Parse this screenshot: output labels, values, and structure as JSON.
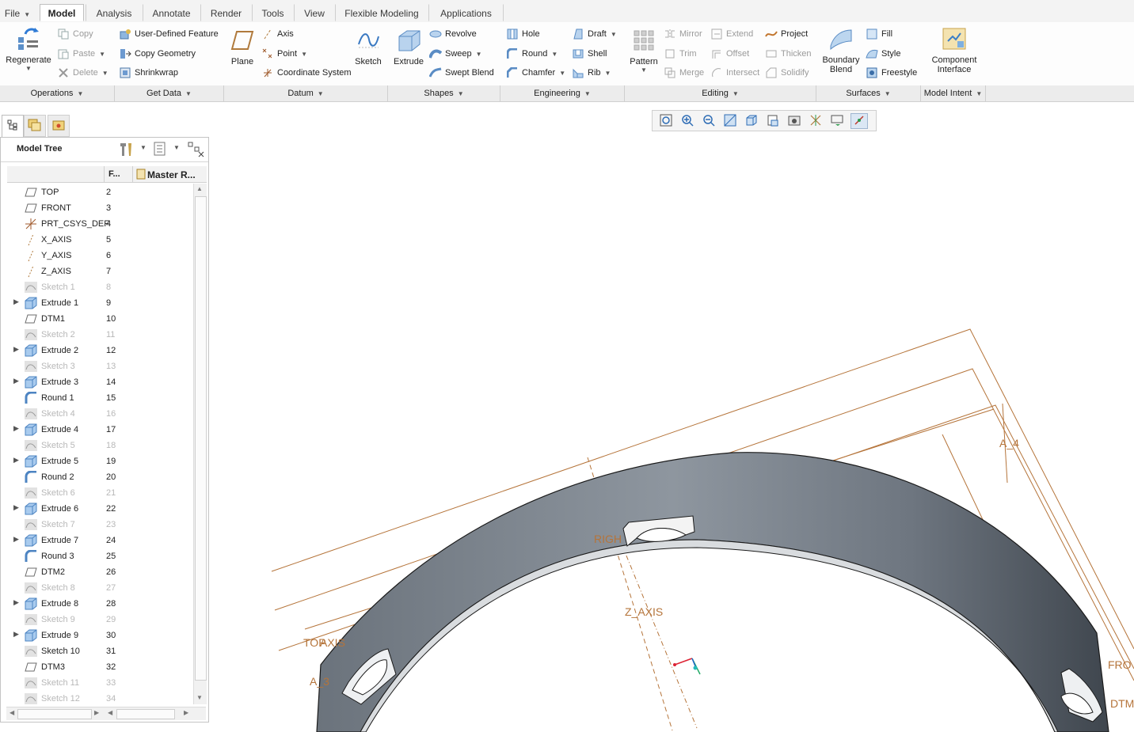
{
  "menu_tabs": [
    "File",
    "Model",
    "Analysis",
    "Annotate",
    "Render",
    "Tools",
    "View",
    "Flexible Modeling",
    "Applications"
  ],
  "ribbon": {
    "regenerate": "Regenerate",
    "copy": "Copy",
    "paste": "Paste",
    "delete": "Delete",
    "user_defined_feature": "User-Defined Feature",
    "copy_geometry": "Copy Geometry",
    "shrinkwrap": "Shrinkwrap",
    "plane": "Plane",
    "axis": "Axis",
    "point": "Point",
    "coordinate_system": "Coordinate System",
    "sketch": "Sketch",
    "extrude": "Extrude",
    "revolve": "Revolve",
    "sweep": "Sweep",
    "swept_blend": "Swept Blend",
    "hole": "Hole",
    "round": "Round",
    "chamfer": "Chamfer",
    "draft": "Draft",
    "shell": "Shell",
    "rib": "Rib",
    "pattern": "Pattern",
    "mirror": "Mirror",
    "trim": "Trim",
    "merge": "Merge",
    "extend": "Extend",
    "offset": "Offset",
    "intersect": "Intersect",
    "project": "Project",
    "thicken": "Thicken",
    "solidify": "Solidify",
    "boundary_blend_1": "Boundary",
    "boundary_blend_2": "Blend",
    "fill": "Fill",
    "style": "Style",
    "freestyle": "Freestyle",
    "component_interface_1": "Component",
    "component_interface_2": "Interface"
  },
  "groups": [
    "Operations",
    "Get Data",
    "Datum",
    "Shapes",
    "Engineering",
    "Editing",
    "Surfaces",
    "Model Intent"
  ],
  "tree": {
    "title": "Model Tree",
    "col_feature": "F...",
    "col_master": "Master R...",
    "items": [
      {
        "name": "TOP",
        "num": "2",
        "icon": "datum-plane",
        "expand": false,
        "dim": false
      },
      {
        "name": "FRONT",
        "num": "3",
        "icon": "datum-plane",
        "expand": false,
        "dim": false
      },
      {
        "name": "PRT_CSYS_DEF",
        "num": "4",
        "icon": "csys",
        "expand": false,
        "dim": false
      },
      {
        "name": "X_AXIS",
        "num": "5",
        "icon": "axis",
        "expand": false,
        "dim": false
      },
      {
        "name": "Y_AXIS",
        "num": "6",
        "icon": "axis",
        "expand": false,
        "dim": false
      },
      {
        "name": "Z_AXIS",
        "num": "7",
        "icon": "axis",
        "expand": false,
        "dim": false
      },
      {
        "name": "Sketch 1",
        "num": "8",
        "icon": "sketch",
        "expand": false,
        "dim": true
      },
      {
        "name": "Extrude 1",
        "num": "9",
        "icon": "extrude",
        "expand": true,
        "dim": false
      },
      {
        "name": "DTM1",
        "num": "10",
        "icon": "datum-plane",
        "expand": false,
        "dim": false
      },
      {
        "name": "Sketch 2",
        "num": "11",
        "icon": "sketch",
        "expand": false,
        "dim": true
      },
      {
        "name": "Extrude 2",
        "num": "12",
        "icon": "extrude",
        "expand": true,
        "dim": false
      },
      {
        "name": "Sketch 3",
        "num": "13",
        "icon": "sketch",
        "expand": false,
        "dim": true
      },
      {
        "name": "Extrude 3",
        "num": "14",
        "icon": "extrude",
        "expand": true,
        "dim": false
      },
      {
        "name": "Round 1",
        "num": "15",
        "icon": "round",
        "expand": false,
        "dim": false
      },
      {
        "name": "Sketch 4",
        "num": "16",
        "icon": "sketch",
        "expand": false,
        "dim": true
      },
      {
        "name": "Extrude 4",
        "num": "17",
        "icon": "extrude",
        "expand": true,
        "dim": false
      },
      {
        "name": "Sketch 5",
        "num": "18",
        "icon": "sketch",
        "expand": false,
        "dim": true
      },
      {
        "name": "Extrude 5",
        "num": "19",
        "icon": "extrude",
        "expand": true,
        "dim": false
      },
      {
        "name": "Round 2",
        "num": "20",
        "icon": "round",
        "expand": false,
        "dim": false
      },
      {
        "name": "Sketch 6",
        "num": "21",
        "icon": "sketch",
        "expand": false,
        "dim": true
      },
      {
        "name": "Extrude 6",
        "num": "22",
        "icon": "extrude",
        "expand": true,
        "dim": false
      },
      {
        "name": "Sketch 7",
        "num": "23",
        "icon": "sketch",
        "expand": false,
        "dim": true
      },
      {
        "name": "Extrude 7",
        "num": "24",
        "icon": "extrude",
        "expand": true,
        "dim": false
      },
      {
        "name": "Round 3",
        "num": "25",
        "icon": "round",
        "expand": false,
        "dim": false
      },
      {
        "name": "DTM2",
        "num": "26",
        "icon": "datum-plane",
        "expand": false,
        "dim": false
      },
      {
        "name": "Sketch 8",
        "num": "27",
        "icon": "sketch",
        "expand": false,
        "dim": true
      },
      {
        "name": "Extrude 8",
        "num": "28",
        "icon": "extrude",
        "expand": true,
        "dim": false
      },
      {
        "name": "Sketch 9",
        "num": "29",
        "icon": "sketch",
        "expand": false,
        "dim": true
      },
      {
        "name": "Extrude 9",
        "num": "30",
        "icon": "extrude",
        "expand": true,
        "dim": false
      },
      {
        "name": "Sketch 10",
        "num": "31",
        "icon": "sketch",
        "expand": false,
        "dim": false
      },
      {
        "name": "DTM3",
        "num": "32",
        "icon": "datum-plane",
        "expand": false,
        "dim": false
      },
      {
        "name": "Sketch 11",
        "num": "33",
        "icon": "sketch",
        "expand": false,
        "dim": true
      },
      {
        "name": "Sketch 12",
        "num": "34",
        "icon": "sketch",
        "expand": false,
        "dim": true
      }
    ]
  },
  "viewport": {
    "labels": {
      "z_axis": "Z_AXIS",
      "top_axis": "TOP",
      "axis_suffix": "AXIS",
      "right": "RIGH",
      "a4": "A_4",
      "a3": "A_3",
      "front": "FRO",
      "dtm": "DTM"
    },
    "colors": {
      "datum": "#b5743a",
      "part_dark": "#4c535c",
      "part_light": "#8b939c",
      "edge": "#1a1a1a"
    }
  }
}
